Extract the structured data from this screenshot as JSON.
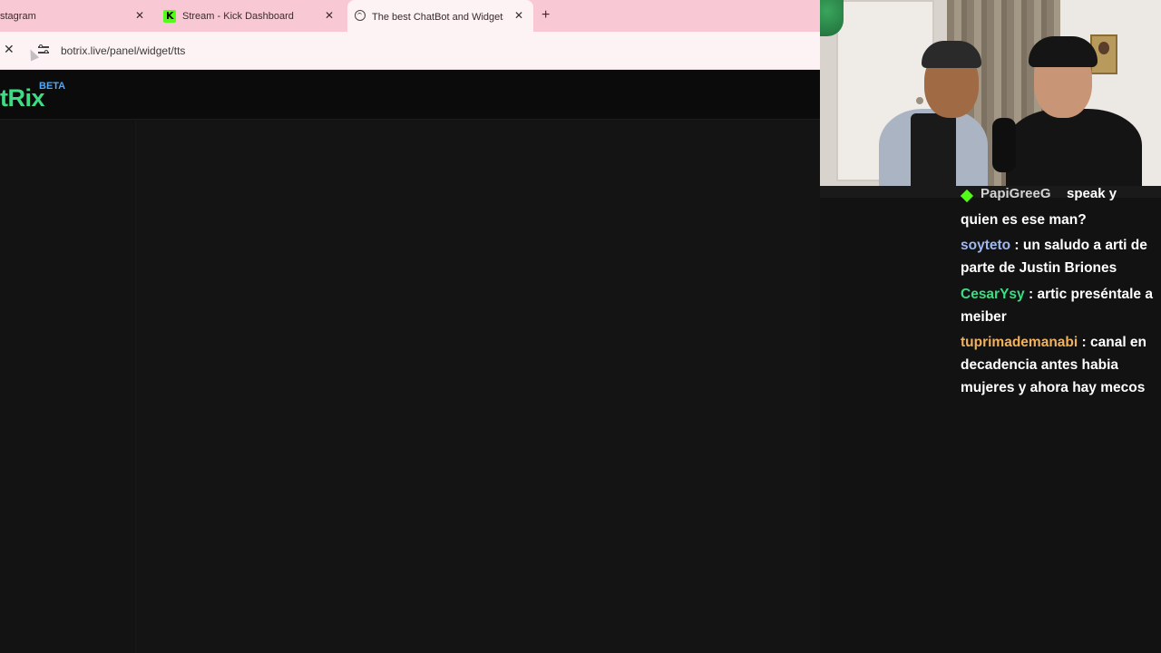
{
  "browser": {
    "tabs": [
      {
        "title": "stagram",
        "active": false
      },
      {
        "title": "Stream - Kick Dashboard",
        "active": false
      },
      {
        "title": "The best ChatBot and Widgets",
        "active": true
      }
    ],
    "new_tab": "+",
    "close_glyph": "✕",
    "url": "botrix.live/panel/widget/tts"
  },
  "app": {
    "logo": "tRix",
    "badge": "BETA",
    "colors": {
      "logo": "#3ddc84",
      "badge": "#4ea8ff"
    }
  },
  "chat": {
    "partial_top": {
      "user": "PapiGreeG",
      "text": "speak y"
    },
    "messages": [
      {
        "user": "",
        "user_color": "#ffffff",
        "text": "quien es ese man?"
      },
      {
        "user": "soyteto",
        "user_color": "#9fb8f0",
        "text": "un saludo a arti de parte de Justin Briones"
      },
      {
        "user": "CesarYsy",
        "user_color": "#3ddc84",
        "text": "artic preséntale a meiber"
      },
      {
        "user": "tuprimademanabi",
        "user_color": "#f2b15c",
        "text": "canal en decadencia antes habia mujeres y ahora hay mecos"
      }
    ]
  }
}
